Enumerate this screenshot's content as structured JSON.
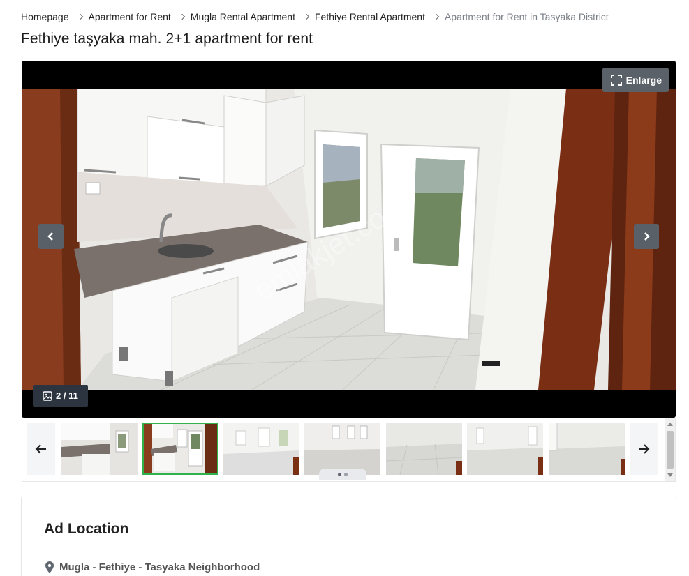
{
  "breadcrumb": {
    "items": [
      {
        "label": "Homepage"
      },
      {
        "label": "Apartment for Rent"
      },
      {
        "label": "Mugla Rental Apartment"
      },
      {
        "label": "Fethiye Rental Apartment"
      },
      {
        "label": "Apartment for Rent in Tasyaka District"
      }
    ]
  },
  "listing": {
    "title": "Fethiye taşyaka mah. 2+1 apartment for rent"
  },
  "gallery": {
    "enlarge_label": "Enlarge",
    "counter": "2 / 11",
    "watermark": "emlakjet.com",
    "icons": {
      "enlarge": "expand-icon",
      "prev": "chevron-left-icon",
      "next": "chevron-right-icon",
      "counter": "image-icon"
    },
    "thumbnails": [
      {
        "scene": "kitchen-wide",
        "active": false
      },
      {
        "scene": "kitchen-door",
        "active": true
      },
      {
        "scene": "empty-room-windows",
        "active": false
      },
      {
        "scene": "empty-room-two-windows",
        "active": false
      },
      {
        "scene": "empty-room-floor",
        "active": false
      },
      {
        "scene": "empty-room-window-right",
        "active": false
      },
      {
        "scene": "empty-room-corner",
        "active": false
      }
    ],
    "strip_icons": {
      "prev": "arrow-left-icon",
      "next": "arrow-right-icon"
    }
  },
  "location": {
    "heading": "Ad Location",
    "address": "Mugla - Fethiye - Tasyaka Neighborhood",
    "icon": "map-pin-icon"
  },
  "colors": {
    "accent_active": "#2fb24c",
    "overlay_button": "#5b6169",
    "counter_bg": "#2c3440"
  }
}
